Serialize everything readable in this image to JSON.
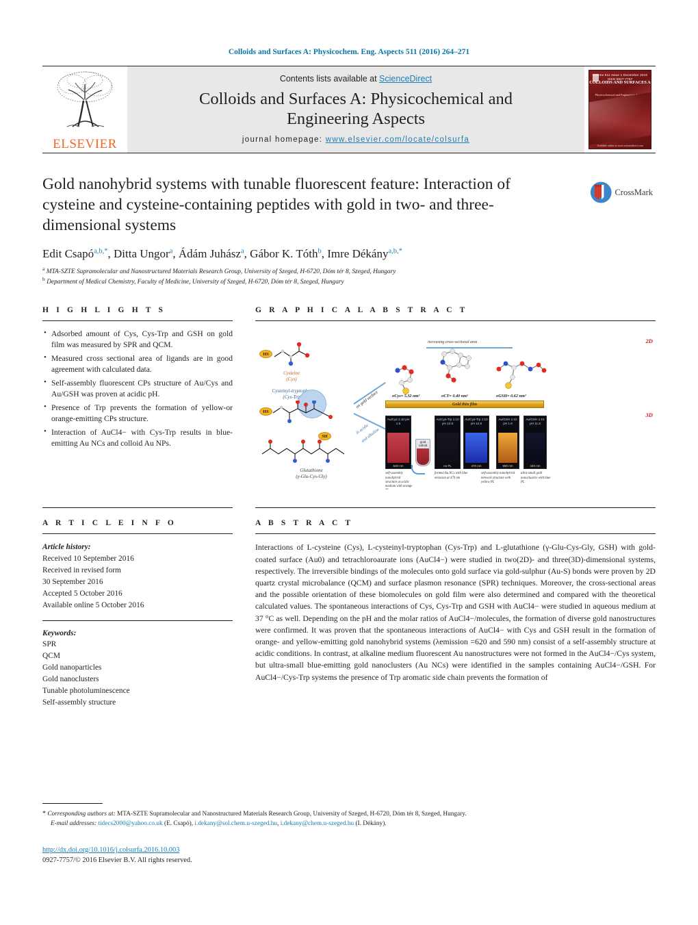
{
  "running_head": "Colloids and Surfaces A: Physicochem. Eng. Aspects 511 (2016) 264–271",
  "masthead": {
    "publisher": "ELSEVIER",
    "contents_prefix": "Contents lists available at ",
    "contents_link": "ScienceDirect",
    "journal_title": "Colloids and Surfaces A: Physicochemical and Engineering Aspects",
    "homepage_prefix": "journal homepage: ",
    "homepage_url": "www.elsevier.com/locate/colsurfa",
    "cover": {
      "top_meta": "Volume 511  Issue 1  December 2016  ISSN 0927-7757",
      "name": "COLLOIDS AND SURFACES A",
      "subtitle": "Physicochemical and Engineering Aspects",
      "footer": "Available online at www.sciencedirect.com"
    }
  },
  "article": {
    "title": "Gold nanohybrid systems with tunable fluorescent feature: Interaction of cysteine and cysteine-containing peptides with gold in two- and three-dimensional systems",
    "crossmark_label": "CrossMark",
    "authors": [
      {
        "name": "Edit Csapó",
        "marks": "a,b,*"
      },
      {
        "name": "Ditta Ungor",
        "marks": "a"
      },
      {
        "name": "Ádám Juhász",
        "marks": "a"
      },
      {
        "name": "Gábor K. Tóth",
        "marks": "b"
      },
      {
        "name": "Imre Dékány",
        "marks": "a,b,*"
      }
    ],
    "affiliations": [
      {
        "mark": "a",
        "text": "MTA-SZTE Supramolecular and Nanostructured Materials Research Group, University of Szeged, H-6720, Dóm tér 8, Szeged, Hungary"
      },
      {
        "mark": "b",
        "text": "Department of Medical Chemistry, Faculty of Medicine, University of Szeged, H-6720, Dóm tér 8, Szeged, Hungary"
      }
    ]
  },
  "sections": {
    "highlights_heading": "H I G H L I G H T S",
    "graphical_abstract_heading": "G R A P H I C A L   A B S T R A C T",
    "article_info_heading": "A R T I C L E   I N F O",
    "abstract_heading": "A B S T R A C T"
  },
  "highlights": [
    "Adsorbed amount of Cys, Cys-Trp and GSH on gold film was measured by SPR and QCM.",
    "Measured cross sectional area of ligands are in good agreement with calculated data.",
    "Self-assembly fluorescent CPs structure of Au/Cys and Au/GSH was proven at acidic pH.",
    "Presence of Trp prevents the formation of yellow-or orange-emitting CPs structure.",
    "Interaction of AuCl4− with Cys-Trp results in blue-emitting Au NCs and colloid Au NPs."
  ],
  "article_info": {
    "history_heading": "Article history:",
    "history": [
      "Received 10 September 2016",
      "Received in revised form",
      "30 September 2016",
      "Accepted 5 October 2016",
      "Available online 5 October 2016"
    ],
    "keywords_heading": "Keywords:",
    "keywords": [
      "SPR",
      "QCM",
      "Gold nanoparticles",
      "Gold nanoclusters",
      "Tunable photoluminescence",
      "Self-assembly structure"
    ]
  },
  "abstract": {
    "paragraph": "Interactions of L-cysteine (Cys), L-cysteinyl-tryptophan (Cys-Trp) and L-glutathione (γ-Glu-Cys-Gly, GSH) with gold-coated surface (Au0) and tetrachloroaurate ions (AuCl4−) were studied in two(2D)- and three(3D)-dimensional systems, respectively. The irreversible bindings of the molecules onto gold surface via gold-sulphur (Au-S) bonds were proven by 2D quartz crystal microbalance (QCM) and surface plasmon resonance (SPR) techniques. Moreover, the cross-sectional areas and the possible orientation of these biomolecules on gold film were also determined and compared with the theoretical calculated values. The spontaneous interactions of Cys, Cys-Trp and GSH with AuCl4− were studied in aqueous medium at 37 °C as well. Depending on the pH and the molar ratios of AuCl4−/molecules, the formation of diverse gold nanostructures were confirmed. It was proven that the spontaneous interactions of AuCl4− with Cys and GSH result in the formation of orange- and yellow-emitting gold nanohybrid systems (λemission =620 and 590 nm) consist of a self-assembly structure at acidic conditions. In contrast, at alkaline medium fluorescent Au nanostructures were not formed in the AuCl4−/Cys system, but ultra-small blue-emitting gold nanoclusters (Au NCs) were identified in the samples containing AuCl4−/GSH. For AuCl4−/Cys-Trp systems the presence of Trp aromatic side chain prevents the formation of"
  },
  "graphical_abstract": {
    "molecules": [
      {
        "name": "Cysteine",
        "formula": "(Cys)",
        "badge": "HS"
      },
      {
        "name": "Cysteinyl-tryptophan",
        "formula": "(Cys-Trp)",
        "badge": "HS"
      },
      {
        "name": "Glutathione",
        "formula": "(γ-Glu-Cys-Gly)",
        "badge": "SH"
      }
    ],
    "film_label": "Gold thin film",
    "increasing_label": "increasing cross-sectional area",
    "cross_sections": [
      "σCys= 5.32 nm²",
      "σCT= 0.40 nm²",
      "σGSH= 0.62 nm²"
    ],
    "dim_2d": "2D",
    "dim_3d": "3D",
    "diagonal_labels": [
      "on gold surface",
      "in acidic",
      "and alkaline"
    ],
    "vials": [
      {
        "title": "Au/Cys 1:10 pH 1.5",
        "wavelength": "620 nm",
        "caption": "self-assembly nanohybrid structure at acidic medium with orange PL",
        "color": "#b32b3a"
      },
      {
        "title": "Au/Cys-Trp 1:10 pH 12.6",
        "wavelength": "no PL",
        "caption": "",
        "color": "#121220"
      },
      {
        "title": "Au/Cys-Trp 1:10 pH 12.6",
        "wavelength": "470 nm",
        "caption": "formed Au NCs with blue emission at 470 nm",
        "color": "#2a50d8"
      },
      {
        "title": "Au/GSH 1:10 pH 1.6",
        "wavelength": "590 nm",
        "caption": "self-assembly nanohybrid network structure with yellow PL",
        "color": "#e08a28"
      },
      {
        "title": "Au/GSH 1:15 pH 11.8",
        "wavelength": "440 nm",
        "caption": "ultra-small gold nanoclusters with blue PL",
        "color": "#101028"
      }
    ],
    "tube_label": "gold colloid"
  },
  "footer": {
    "corresponding_star": "*",
    "corresponding_label": "Corresponding authors at:",
    "corresponding_text": " MTA-SZTE Supramolecular and Nanostructured Materials Research Group, University of Szeged, H-6720, Dóm tér 8, Szeged, Hungary.",
    "email_label": "E-mail addresses:",
    "emails": [
      {
        "address": "tidecs2000@yahoo.co.uk",
        "who": " (E. Csapó),"
      },
      {
        "address": "i.dekany@sol.chem.u-szeged.hu",
        "who": ","
      },
      {
        "address": "i.dekany@chem.u-szeged.hu",
        "who": " (I. Dékány)."
      }
    ],
    "doi": "http://dx.doi.org/10.1016/j.colsurfa.2016.10.003",
    "issn": "0927-7757/© 2016 Elsevier B.V. All rights reserved."
  }
}
